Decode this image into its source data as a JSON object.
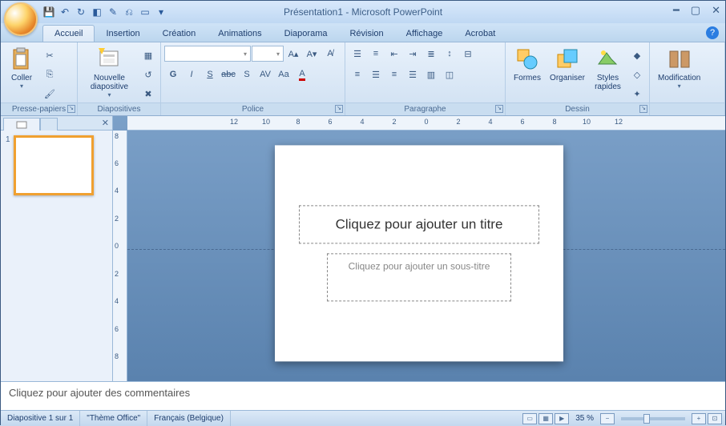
{
  "title": "Présentation1 - Microsoft PowerPoint",
  "tabs": [
    "Accueil",
    "Insertion",
    "Création",
    "Animations",
    "Diaporama",
    "Révision",
    "Affichage",
    "Acrobat"
  ],
  "groups": {
    "clipboard": "Presse-papiers",
    "slides": "Diapositives",
    "font": "Police",
    "paragraph": "Paragraphe",
    "drawing": "Dessin",
    "editing": "Modification"
  },
  "buttons": {
    "paste": "Coller",
    "newslide": "Nouvelle diapositive",
    "shapes": "Formes",
    "arrange": "Organiser",
    "quickstyles": "Styles rapides",
    "editing": "Modification"
  },
  "font": {
    "name": "",
    "size": ""
  },
  "ruler_h": [
    "12",
    "10",
    "8",
    "6",
    "4",
    "2",
    "0",
    "2",
    "4",
    "6",
    "8",
    "10",
    "12"
  ],
  "ruler_v": [
    "8",
    "6",
    "4",
    "2",
    "0",
    "2",
    "4",
    "6",
    "8"
  ],
  "placeholders": {
    "title": "Cliquez pour ajouter un titre",
    "subtitle": "Cliquez pour ajouter un sous-titre",
    "notes": "Cliquez pour ajouter des commentaires"
  },
  "thumb_num": "1",
  "status": {
    "slide": "Diapositive 1 sur 1",
    "theme": "\"Thème Office\"",
    "lang": "Français (Belgique)",
    "zoom": "35 %"
  }
}
